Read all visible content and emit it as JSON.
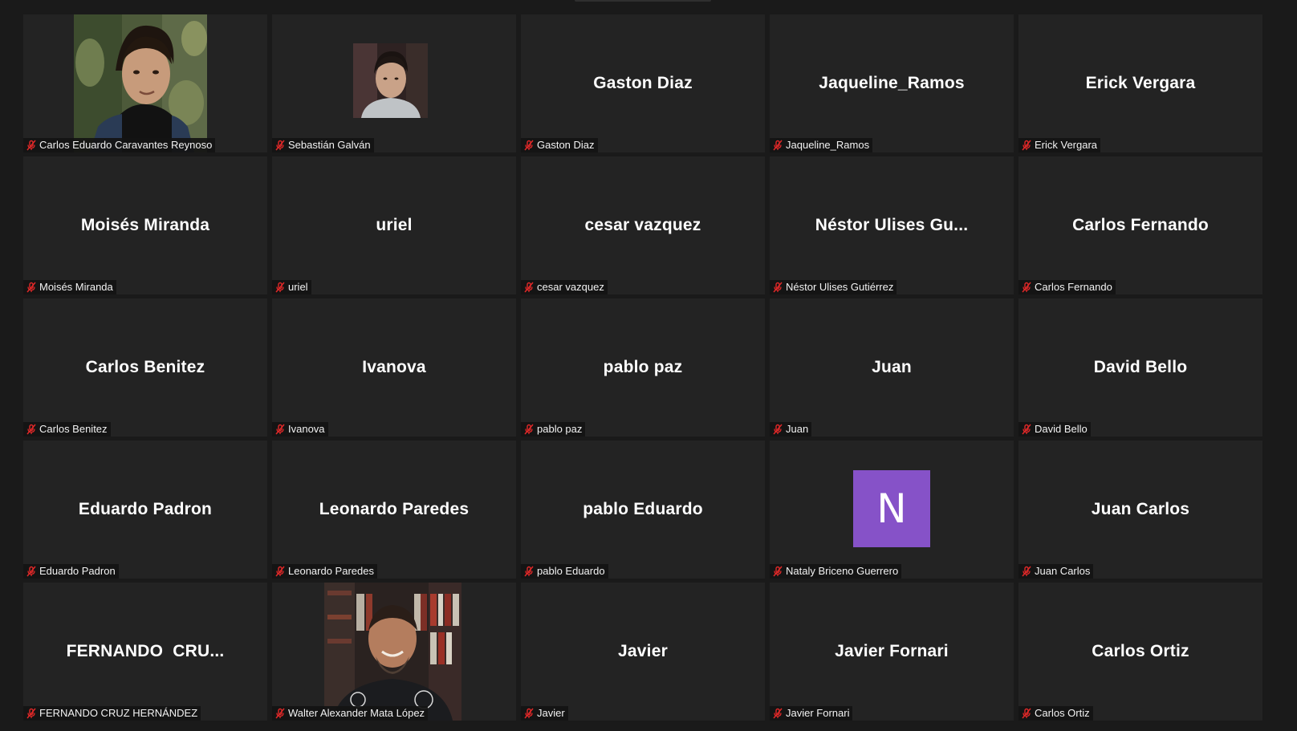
{
  "meeting": {
    "view": "gallery",
    "mic_status_icon": "mic-muted-icon",
    "mic_muted_color": "#e02828",
    "tile_background": "#232323",
    "avatar_color": "#8652c8"
  },
  "participants": [
    {
      "display_name": "",
      "name_tag": "Carlos Eduardo Caravantes Reynoso",
      "type": "video"
    },
    {
      "display_name": "",
      "name_tag": "Sebastián Galván",
      "type": "photo"
    },
    {
      "display_name": "Gaston Diaz",
      "name_tag": "Gaston Diaz",
      "type": "name"
    },
    {
      "display_name": "Jaqueline_Ramos",
      "name_tag": "Jaqueline_Ramos",
      "type": "name"
    },
    {
      "display_name": "Erick Vergara",
      "name_tag": "Erick Vergara",
      "type": "name"
    },
    {
      "display_name": "Moisés Miranda",
      "name_tag": "Moisés Miranda",
      "type": "name"
    },
    {
      "display_name": "uriel",
      "name_tag": "uriel",
      "type": "name"
    },
    {
      "display_name": "cesar vazquez",
      "name_tag": "cesar vazquez",
      "type": "name"
    },
    {
      "display_name": "Néstor Ulises Gu...",
      "name_tag": "Néstor Ulises Gutiérrez",
      "type": "name"
    },
    {
      "display_name": "Carlos Fernando",
      "name_tag": "Carlos Fernando",
      "type": "name"
    },
    {
      "display_name": "Carlos Benitez",
      "name_tag": "Carlos Benitez",
      "type": "name"
    },
    {
      "display_name": "Ivanova",
      "name_tag": "Ivanova",
      "type": "name"
    },
    {
      "display_name": "pablo paz",
      "name_tag": "pablo paz",
      "type": "name"
    },
    {
      "display_name": "Juan",
      "name_tag": "Juan",
      "type": "name"
    },
    {
      "display_name": "David Bello",
      "name_tag": "David Bello",
      "type": "name"
    },
    {
      "display_name": "Eduardo Padron",
      "name_tag": "Eduardo Padron",
      "type": "name"
    },
    {
      "display_name": "Leonardo Paredes",
      "name_tag": "Leonardo Paredes",
      "type": "name"
    },
    {
      "display_name": "pablo Eduardo",
      "name_tag": "pablo Eduardo",
      "type": "name"
    },
    {
      "display_name": "",
      "avatar_letter": "N",
      "name_tag": "Nataly Briceno Guerrero",
      "type": "avatar"
    },
    {
      "display_name": "Juan Carlos",
      "name_tag": "Juan Carlos",
      "type": "name"
    },
    {
      "display_name": "FERNANDO  CRU...",
      "name_tag": "FERNANDO CRUZ HERNÁNDEZ",
      "type": "name"
    },
    {
      "display_name": "",
      "name_tag": "Walter Alexander Mata López",
      "type": "video"
    },
    {
      "display_name": "Javier",
      "name_tag": "Javier",
      "type": "name"
    },
    {
      "display_name": "Javier Fornari",
      "name_tag": "Javier Fornari",
      "type": "name"
    },
    {
      "display_name": "Carlos Ortiz",
      "name_tag": "Carlos Ortiz",
      "type": "name"
    }
  ]
}
